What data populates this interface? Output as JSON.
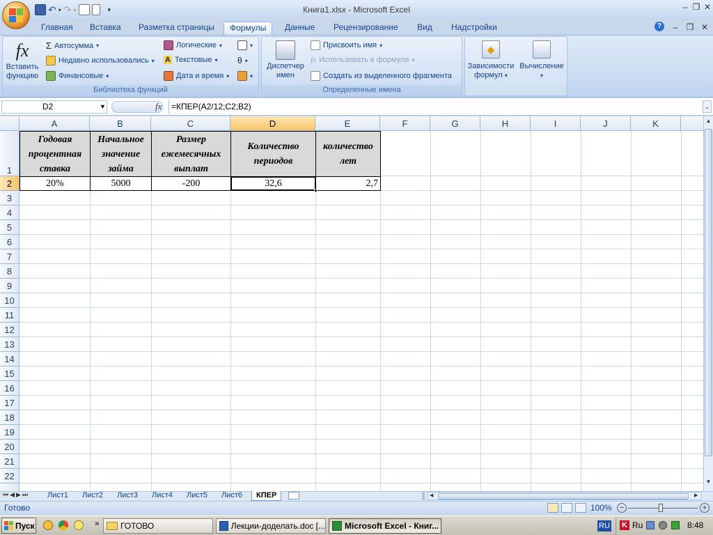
{
  "window": {
    "title": "Книга1.xlsx - Microsoft Excel"
  },
  "ribbon_tabs": [
    "Главная",
    "Вставка",
    "Разметка страницы",
    "Формулы",
    "Данные",
    "Рецензирование",
    "Вид",
    "Надстройки"
  ],
  "active_tab": "Формулы",
  "ribbon": {
    "insert_function": {
      "line1": "Вставить",
      "line2": "функцию"
    },
    "autosum": "Автосумма",
    "recent": "Недавно использовались",
    "financial": "Финансовые",
    "logical": "Логические",
    "text": "Текстовые",
    "datetime": "Дата и время",
    "library_title": "Библиотека функций",
    "name_manager": {
      "line1": "Диспетчер",
      "line2": "имен"
    },
    "assign_name": "Присвоить имя",
    "use_in_formula": "Использовать в формуле",
    "create_from_selection": "Создать из выделенного фрагмента",
    "defined_names_title": "Определенные имена",
    "dependencies": {
      "line1": "Зависимости",
      "line2": "формул"
    },
    "calculation": "Вычисление"
  },
  "formula_bar": {
    "name_box": "D2",
    "fx": "fx",
    "formula": "=КПЕР(A2/12;C2;B2)"
  },
  "columns": [
    "A",
    "B",
    "C",
    "D",
    "E",
    "F",
    "G",
    "H",
    "I",
    "J",
    "K"
  ],
  "rows": [
    "1",
    "2",
    "3",
    "4",
    "5",
    "6",
    "7",
    "8",
    "9",
    "10",
    "11",
    "12",
    "13",
    "14",
    "15",
    "16",
    "17",
    "18",
    "19",
    "20",
    "21",
    "22"
  ],
  "headers": [
    {
      "lines": [
        "Годовая",
        "процентная",
        "ставка"
      ]
    },
    {
      "lines": [
        "Начальное",
        "значение",
        "займа"
      ]
    },
    {
      "lines": [
        "Размер",
        "ежемесячных",
        "выплат"
      ]
    },
    {
      "lines": [
        "Количество",
        "периодов"
      ]
    },
    {
      "lines": [
        "количество",
        "лет"
      ]
    }
  ],
  "data_row": [
    "20%",
    "5000",
    "-200",
    "32,6",
    "2,7"
  ],
  "sheets": [
    "Лист1",
    "Лист2",
    "Лист3",
    "Лист4",
    "Лист5",
    "Лист6",
    "КПЕР"
  ],
  "active_sheet": "КПЕР",
  "status": {
    "ready": "Готово",
    "zoom": "100%"
  },
  "taskbar": {
    "start": "Пуск",
    "chevron": "»",
    "items": [
      "ГОТОВО",
      "Лекции-доделать.doc [...",
      "Microsoft Excel - Книг..."
    ],
    "lang": "RU",
    "tray_lang": "Ru",
    "clock": "8:48"
  }
}
